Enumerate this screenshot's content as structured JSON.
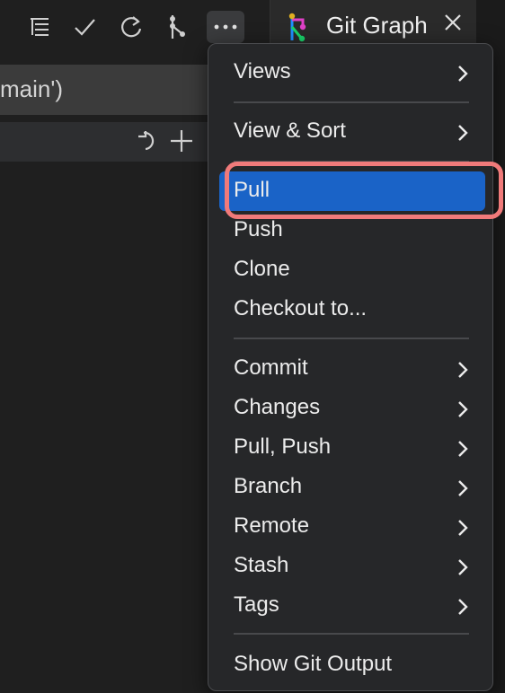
{
  "tab": {
    "title": "Git Graph"
  },
  "left_panel": {
    "input_text": "main')"
  },
  "menu": {
    "items": [
      {
        "label": "Views",
        "submenu": true
      },
      {
        "label": "View & Sort",
        "submenu": true
      },
      {
        "label": "Pull",
        "active": true
      },
      {
        "label": "Push"
      },
      {
        "label": "Clone"
      },
      {
        "label": "Checkout to..."
      },
      {
        "label": "Commit",
        "submenu": true
      },
      {
        "label": "Changes",
        "submenu": true
      },
      {
        "label": "Pull, Push",
        "submenu": true
      },
      {
        "label": "Branch",
        "submenu": true
      },
      {
        "label": "Remote",
        "submenu": true
      },
      {
        "label": "Stash",
        "submenu": true
      },
      {
        "label": "Tags",
        "submenu": true
      },
      {
        "label": "Show Git Output"
      }
    ]
  },
  "colors": {
    "accent": "#1a63c7",
    "highlight": "#f07a7a",
    "menu_bg": "#262729"
  }
}
